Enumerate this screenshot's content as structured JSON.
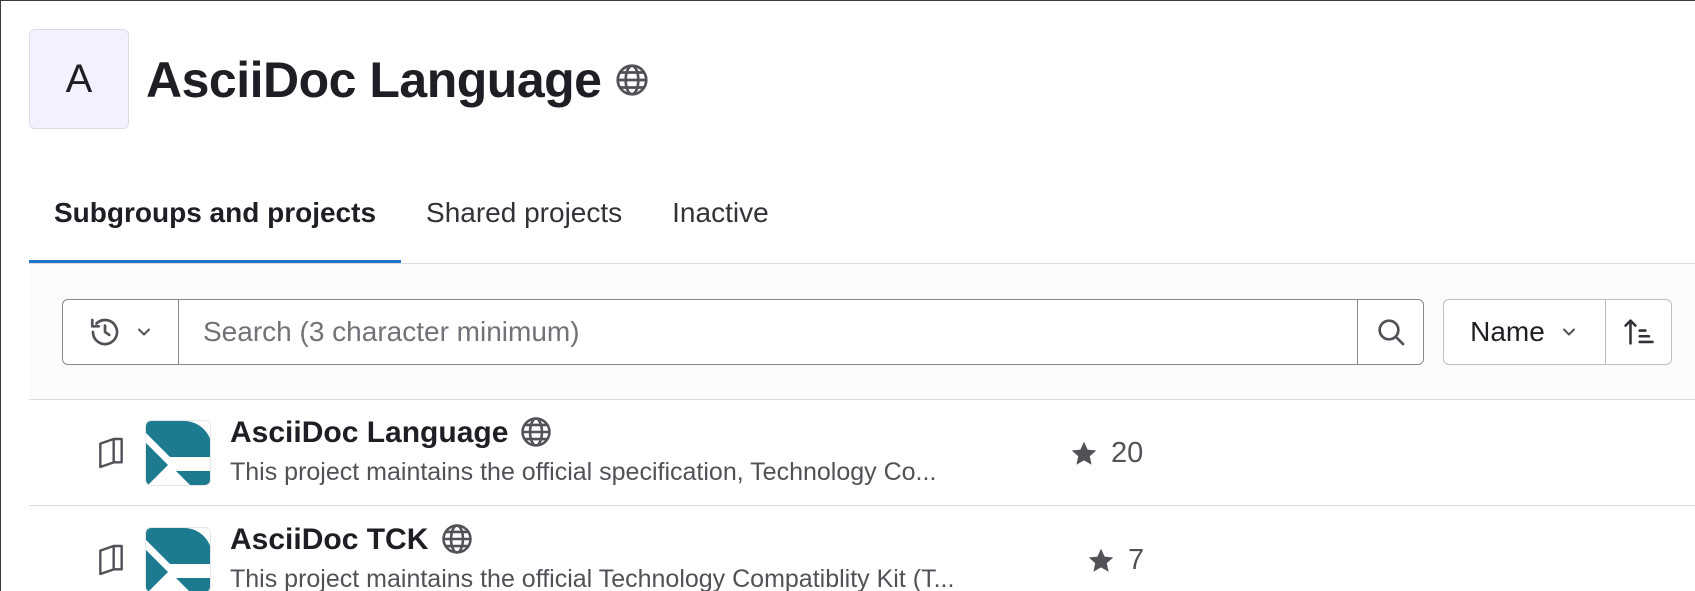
{
  "group": {
    "avatar_letter": "A",
    "title": "AsciiDoc Language",
    "visibility_icon": "globe-icon"
  },
  "tabs": [
    {
      "label": "Subgroups and projects",
      "active": true
    },
    {
      "label": "Shared projects",
      "active": false
    },
    {
      "label": "Inactive",
      "active": false
    }
  ],
  "filter": {
    "history_icon": "history-icon",
    "search_placeholder": "Search (3 character minimum)",
    "search_value": "",
    "search_icon": "search-icon",
    "sort_label": "Name",
    "sort_direction_icon": "sort-ascending-icon"
  },
  "projects": [
    {
      "name": "AsciiDoc Language",
      "description": "This project maintains the official specification, Technology Co...",
      "stars": "20",
      "type_icon": "book-icon",
      "visibility_icon": "globe-icon"
    },
    {
      "name": "AsciiDoc TCK",
      "description": "This project maintains the official Technology Compatiblity Kit (T...",
      "stars": "7",
      "type_icon": "book-icon",
      "visibility_icon": "globe-icon"
    }
  ],
  "colors": {
    "accent": "#1f75cb",
    "avatar_bg": "#f4f0ff",
    "project_logo": "#1e7a8e"
  }
}
